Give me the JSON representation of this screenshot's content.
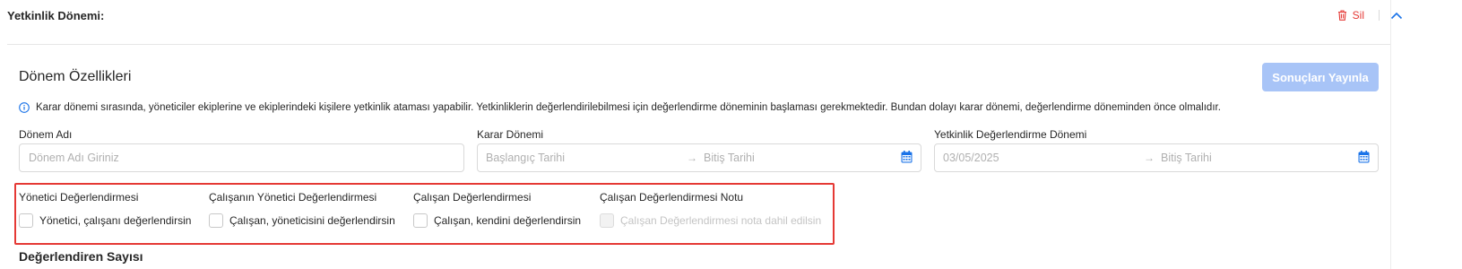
{
  "header": {
    "title": "Yetkinlik Dönemi:",
    "delete_label": "Sil",
    "delete_icon": "trash-icon",
    "collapse_icon": "chevron-up-icon"
  },
  "section": {
    "title": "Dönem Özellikleri",
    "publish_label": "Sonuçları Yayınla",
    "info_text": "Karar dönemi sırasında, yöneticiler ekiplerine ve ekiplerindeki kişilere yetkinlik ataması yapabilir. Yetkinliklerin değerlendirilebilmesi için değerlendirme döneminin başlaması gerekmektedir. Bundan dolayı karar dönemi, değerlendirme döneminden önce olmalıdır."
  },
  "fields": {
    "period_name": {
      "label": "Dönem Adı",
      "placeholder": "Dönem Adı Giriniz",
      "value": ""
    },
    "decision_period": {
      "label": "Karar Dönemi",
      "start_placeholder": "Başlangıç Tarihi",
      "end_placeholder": "Bitiş Tarihi"
    },
    "evaluation_period": {
      "label": "Yetkinlik Değerlendirme Dönemi",
      "start_value": "03/05/2025",
      "end_placeholder": "Bitiş Tarihi"
    }
  },
  "evaluation_options": [
    {
      "title": "Yönetici Değerlendirmesi",
      "checkbox_label": "Yönetici, çalışanı değerlendirsin",
      "checked": false,
      "disabled": false
    },
    {
      "title": "Çalışanın Yönetici Değerlendirmesi",
      "checkbox_label": "Çalışan, yöneticisini değerlendirsin",
      "checked": false,
      "disabled": false
    },
    {
      "title": "Çalışan Değerlendirmesi",
      "checkbox_label": "Çalışan, kendini değerlendirsin",
      "checked": false,
      "disabled": false
    },
    {
      "title": "Çalışan Değerlendirmesi Notu",
      "checkbox_label": "Çalışan Değerlendirmesi nota dahil edilsin",
      "checked": false,
      "disabled": true
    }
  ],
  "next_section": {
    "title": "Değerlendiren Sayısı"
  },
  "colors": {
    "primary": "#1a73e8",
    "publish_disabled": "#a8c4f7",
    "danger": "#e53935",
    "highlight_box": "#e53935"
  }
}
